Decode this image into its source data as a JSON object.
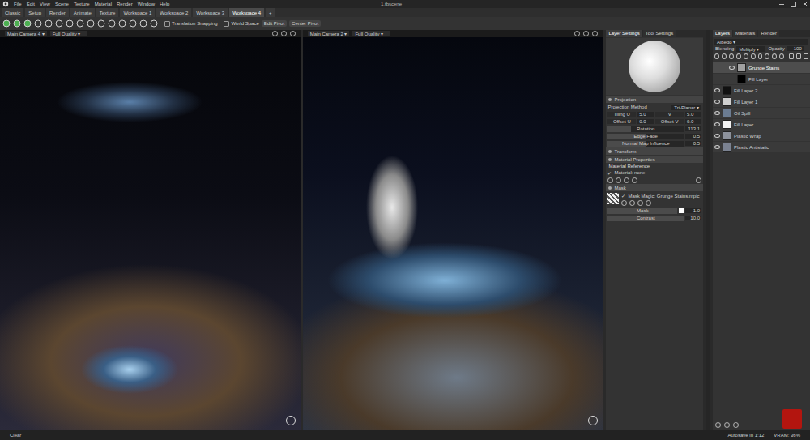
{
  "window": {
    "title": "1.tbscene"
  },
  "menu": [
    "File",
    "Edit",
    "View",
    "Scene",
    "Texture",
    "Material",
    "Render",
    "Window",
    "Help"
  ],
  "workspace_tabs": [
    {
      "label": "Classic",
      "selected": false
    },
    {
      "label": "Setup",
      "selected": false
    },
    {
      "label": "Render",
      "selected": false
    },
    {
      "label": "Animate",
      "selected": false
    },
    {
      "label": "Texture",
      "selected": false
    },
    {
      "label": "Workspace 1",
      "selected": false
    },
    {
      "label": "Workspace 2",
      "selected": false
    },
    {
      "label": "Workspace 3",
      "selected": false
    },
    {
      "label": "Workspace 4",
      "selected": true
    },
    {
      "label": "+",
      "selected": false
    }
  ],
  "toolbar": {
    "options": [
      {
        "label": "Translation Snapping",
        "checked": false
      },
      {
        "label": "World Space",
        "checked": false
      }
    ],
    "buttons": [
      "Edit Pivot",
      "Center Pivot"
    ]
  },
  "viewports": [
    {
      "camera": "Main Camera 4",
      "quality": "Full Quality"
    },
    {
      "camera": "Main Camera 2",
      "quality": "Full Quality"
    }
  ],
  "layer_settings": {
    "tabs": [
      {
        "label": "Layer Settings",
        "selected": true
      },
      {
        "label": "Tool Settings",
        "selected": false
      }
    ],
    "projection": {
      "title": "Projection",
      "expanded": true,
      "rows": [
        {
          "kind": "dropdown",
          "label": "Projection Method",
          "value": "Tri-Planar"
        },
        {
          "kind": "pair",
          "label": "Tiling U",
          "value": "5.0",
          "label2": "V",
          "value2": "5.0"
        },
        {
          "kind": "pair",
          "label": "Offset U",
          "value": "0.0",
          "label2": "Offset V",
          "value2": "0.0"
        },
        {
          "kind": "slider",
          "label": "Rotation",
          "value": "113.1",
          "level": 0.31
        },
        {
          "kind": "slider",
          "label": "Edge Fade",
          "value": "0.5",
          "level": 0.5
        },
        {
          "kind": "slider",
          "label": "Normal Map Influence",
          "value": "0.5",
          "level": 0.5
        }
      ]
    },
    "transform": {
      "title": "Transform",
      "expanded": false
    },
    "material": {
      "title": "Material Properties",
      "expanded": true,
      "subtitle": "Material Reference",
      "checkbox": {
        "label": "Material: none",
        "checked": true
      }
    },
    "mask": {
      "title": "Mask",
      "expanded": true,
      "checkbox": {
        "label": "Mask Magic: Grunge Stains.mpic",
        "checked": true
      },
      "rows": [
        {
          "kind": "slider",
          "label": "Mask",
          "value": "1.0",
          "level": 1.0
        },
        {
          "kind": "slider",
          "label": "Contrast",
          "value": "10.0",
          "level": 1.0
        }
      ]
    }
  },
  "layers_panel": {
    "tabs": [
      {
        "label": "Layers",
        "selected": true
      },
      {
        "label": "Materials",
        "selected": false
      },
      {
        "label": "Render",
        "selected": false
      }
    ],
    "channel": "Albedo",
    "blending_label": "Blending",
    "blending": "Multiply",
    "opacity_label": "Opacity",
    "opacity": "100",
    "layers": [
      {
        "name": "Grunge Stains",
        "selected": true,
        "visible": true,
        "child": true,
        "color": "#a0a0a0"
      },
      {
        "name": "Fill Layer",
        "selected": false,
        "visible": false,
        "child": true,
        "color": "#000000"
      },
      {
        "name": "Fill Layer 2",
        "selected": false,
        "visible": true,
        "child": false,
        "color": "#111111"
      },
      {
        "name": "Fill Layer 1",
        "selected": false,
        "visible": true,
        "child": false,
        "color": "#cfcfcf"
      },
      {
        "name": "Oil Spill",
        "selected": false,
        "visible": true,
        "child": false,
        "color": "#6b7c92"
      },
      {
        "name": "Fill Layer",
        "selected": false,
        "visible": true,
        "child": false,
        "color": "#f2f2f2"
      },
      {
        "name": "Plastic Wrap",
        "selected": false,
        "visible": true,
        "child": false,
        "color": "#8d929c"
      },
      {
        "name": "Plastic Antistatic",
        "selected": false,
        "visible": true,
        "child": false,
        "color": "#7b8291"
      }
    ]
  },
  "status_bar": {
    "left": "Clear",
    "autosave": "Autosave in 1:12",
    "vram": "VRAM: 36%"
  }
}
